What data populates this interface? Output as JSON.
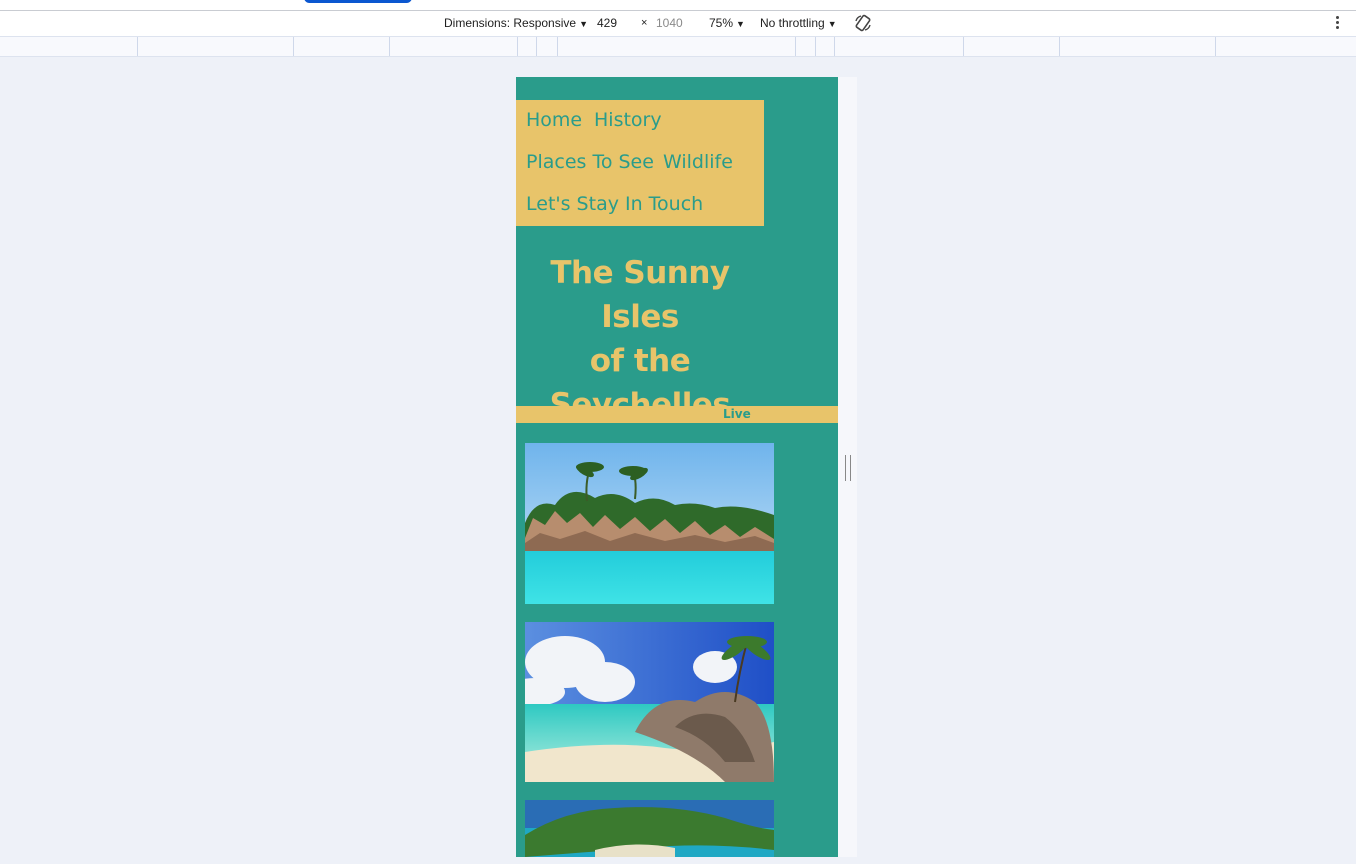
{
  "devtools": {
    "dimensions_label": "Dimensions: Responsive",
    "width_value": "429",
    "times_sign": "×",
    "height_value": "1040",
    "zoom_label": "75%",
    "throttling_label": "No throttling",
    "caret": "▼"
  },
  "site": {
    "nav": {
      "home": "Home",
      "history": "History",
      "places": "Places To See",
      "wildlife": "Wildlife",
      "contact": "Let's Stay In Touch"
    },
    "title_line1": "The Sunny Isles",
    "title_line2": "of the",
    "title_line3": "Seychelles",
    "live_label": "Live"
  },
  "colors": {
    "teal": "#2a9c8b",
    "gold": "#e8c46a"
  }
}
